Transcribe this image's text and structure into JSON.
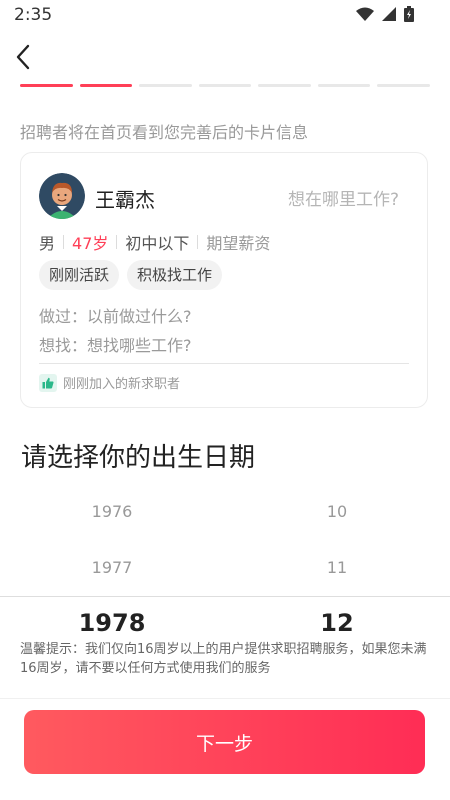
{
  "status_bar": {
    "time": "2:35"
  },
  "progress": {
    "total_steps": 7,
    "completed_steps": 2
  },
  "hint": "招聘者将在首页看到您完善后的卡片信息",
  "card": {
    "name": "王霸杰",
    "where": "想在哪里工作?",
    "gender": "男",
    "age": "47岁",
    "education": "初中以下",
    "salary": "期望薪资",
    "tags": [
      "刚刚活跃",
      "积极找工作"
    ],
    "did": "做过：以前做过什么?",
    "seek": "想找：想找哪些工作?",
    "new_label": "刚刚加入的新求职者"
  },
  "section_title": "请选择你的出生日期",
  "picker": {
    "years": [
      "1976",
      "1977",
      "1978"
    ],
    "months": [
      "10",
      "11",
      "12"
    ],
    "selected_year": "1978",
    "selected_month": "12"
  },
  "warning": "温馨提示：我们仅向16周岁以上的用户提供求职招聘服务，如果您未满16周岁，请不要以任何方式使用我们的服务",
  "next_button": "下一步",
  "colors": {
    "accent": "#ff3f57",
    "button_from": "#ff5a5f",
    "button_to": "#ff2d55"
  }
}
